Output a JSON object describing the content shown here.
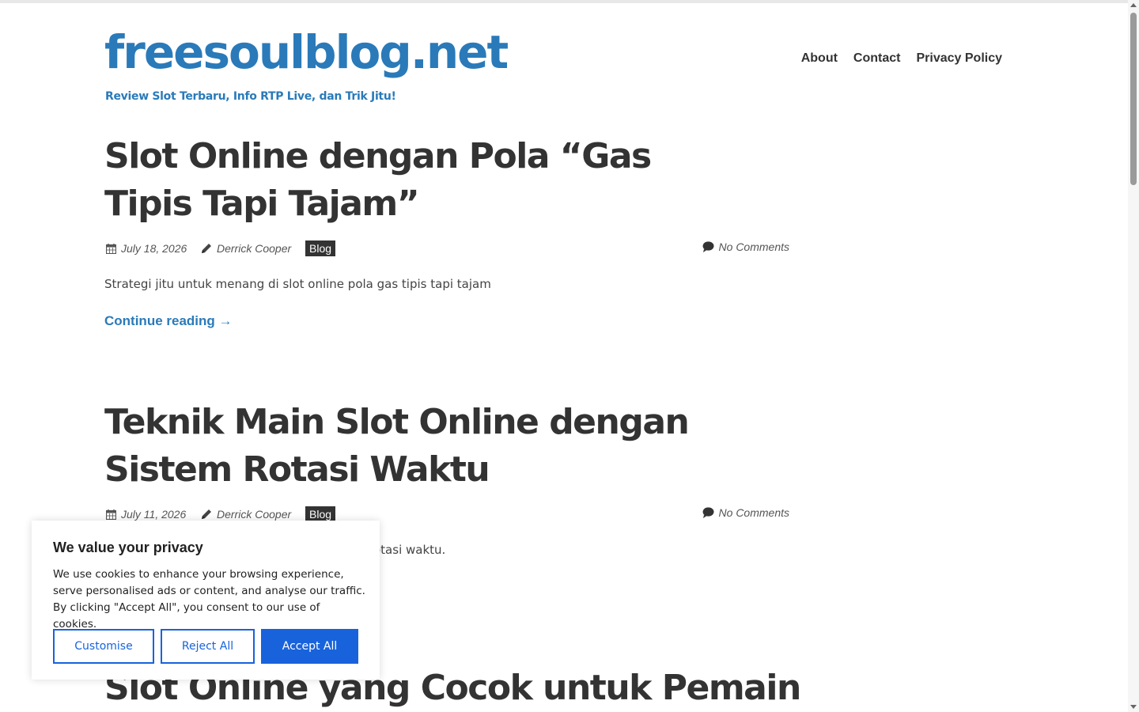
{
  "site": {
    "title": "freesoulblog.net",
    "tagline": "Review Slot Terbaru, Info RTP Live, dan Trik Jitu!",
    "accent_color": "#2a7ab9"
  },
  "nav": {
    "items": [
      "About",
      "Contact",
      "Privacy Policy"
    ]
  },
  "posts": [
    {
      "title": "Slot Online dengan Pola “Gas Tipis Tapi Tajam”",
      "date": "July 18, 2026",
      "author": "Derrick Cooper",
      "category": "Blog",
      "comments": "No Comments",
      "excerpt": "Strategi jitu untuk menang di slot online pola gas tipis tapi tajam",
      "read_more": "Continue reading →"
    },
    {
      "title": "Teknik Main Slot Online dengan Sistem Rotasi Waktu",
      "date": "July 11, 2026",
      "author": "Derrick Cooper",
      "category": "Blog",
      "comments": "No Comments",
      "excerpt_visible_fragment": "otasi waktu."
    },
    {
      "title_visible_fragment": "Slot Online yang Cocok untuk Pemain"
    }
  ],
  "icons": {
    "date": "calendar-icon",
    "author": "pencil-icon",
    "comments": "comment-icon"
  },
  "cookie_banner": {
    "title": "We value your privacy",
    "text": "We use cookies to enhance your browsing experience, serve personalised ads or content, and analyse our traffic. By clicking \"Accept All\", you consent to our use of cookies.",
    "customise_label": "Customise",
    "reject_label": "Reject All",
    "accept_label": "Accept All",
    "button_color": "#1863dc"
  }
}
